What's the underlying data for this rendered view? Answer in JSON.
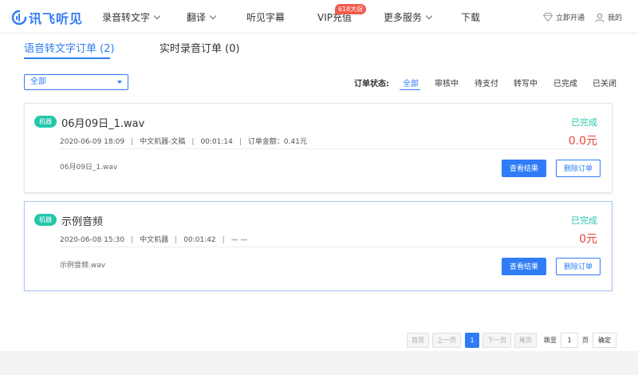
{
  "brand": {
    "name": "讯飞听见",
    "color": "#2f7cf6"
  },
  "nav": {
    "items": [
      {
        "label": "录音转文字",
        "dropdown": true
      },
      {
        "label": "翻译",
        "dropdown": true
      },
      {
        "label": "听见字幕",
        "dropdown": false
      },
      {
        "label": "VIP充值",
        "dropdown": false
      },
      {
        "label": "更多服务",
        "dropdown": true
      },
      {
        "label": "下载",
        "dropdown": false
      }
    ],
    "promo_badge": "618大促",
    "vip_link": "立即开通",
    "user_link": "我的"
  },
  "tabs": [
    {
      "label": "语音转文字订单 (2)",
      "active": true
    },
    {
      "label": "实时录音订单 (0)",
      "active": false
    }
  ],
  "filter": {
    "selected": "全部"
  },
  "status_filter": {
    "label": "订单状态:",
    "options": [
      "全部",
      "审核中",
      "待支付",
      "转写中",
      "已完成",
      "已关闭"
    ],
    "active_index": 0
  },
  "orders": [
    {
      "tag": "机器",
      "title": "06月09日_1.wav",
      "date": "2020-06-09 18:09",
      "service": "中文机器-文稿",
      "duration": "00:01:14",
      "amount": "订单金额：0.41元",
      "file": "06月09日_1.wav",
      "status": "已完成",
      "price": "0.0元",
      "view_label": "查看结果",
      "delete_label": "删除订单"
    },
    {
      "tag": "机器",
      "title": "示例音频",
      "date": "2020-06-08 15:30",
      "service": "中文机器",
      "duration": "00:01:42",
      "amount": "— —",
      "file": "示例音频.wav",
      "status": "已完成",
      "price": "0元",
      "view_label": "查看结果",
      "delete_label": "删除订单"
    }
  ],
  "pagination": {
    "first": "首页",
    "prev": "上一页",
    "current": "1",
    "next": "下一页",
    "last": "尾页",
    "goto_label": "跳至",
    "goto_value": "1",
    "page_unit": "页",
    "confirm": "确定"
  },
  "colors": {
    "accent": "#2f7cf6",
    "success": "#25c6a8",
    "price": "#e8453c",
    "promo": "#f25a4a"
  }
}
